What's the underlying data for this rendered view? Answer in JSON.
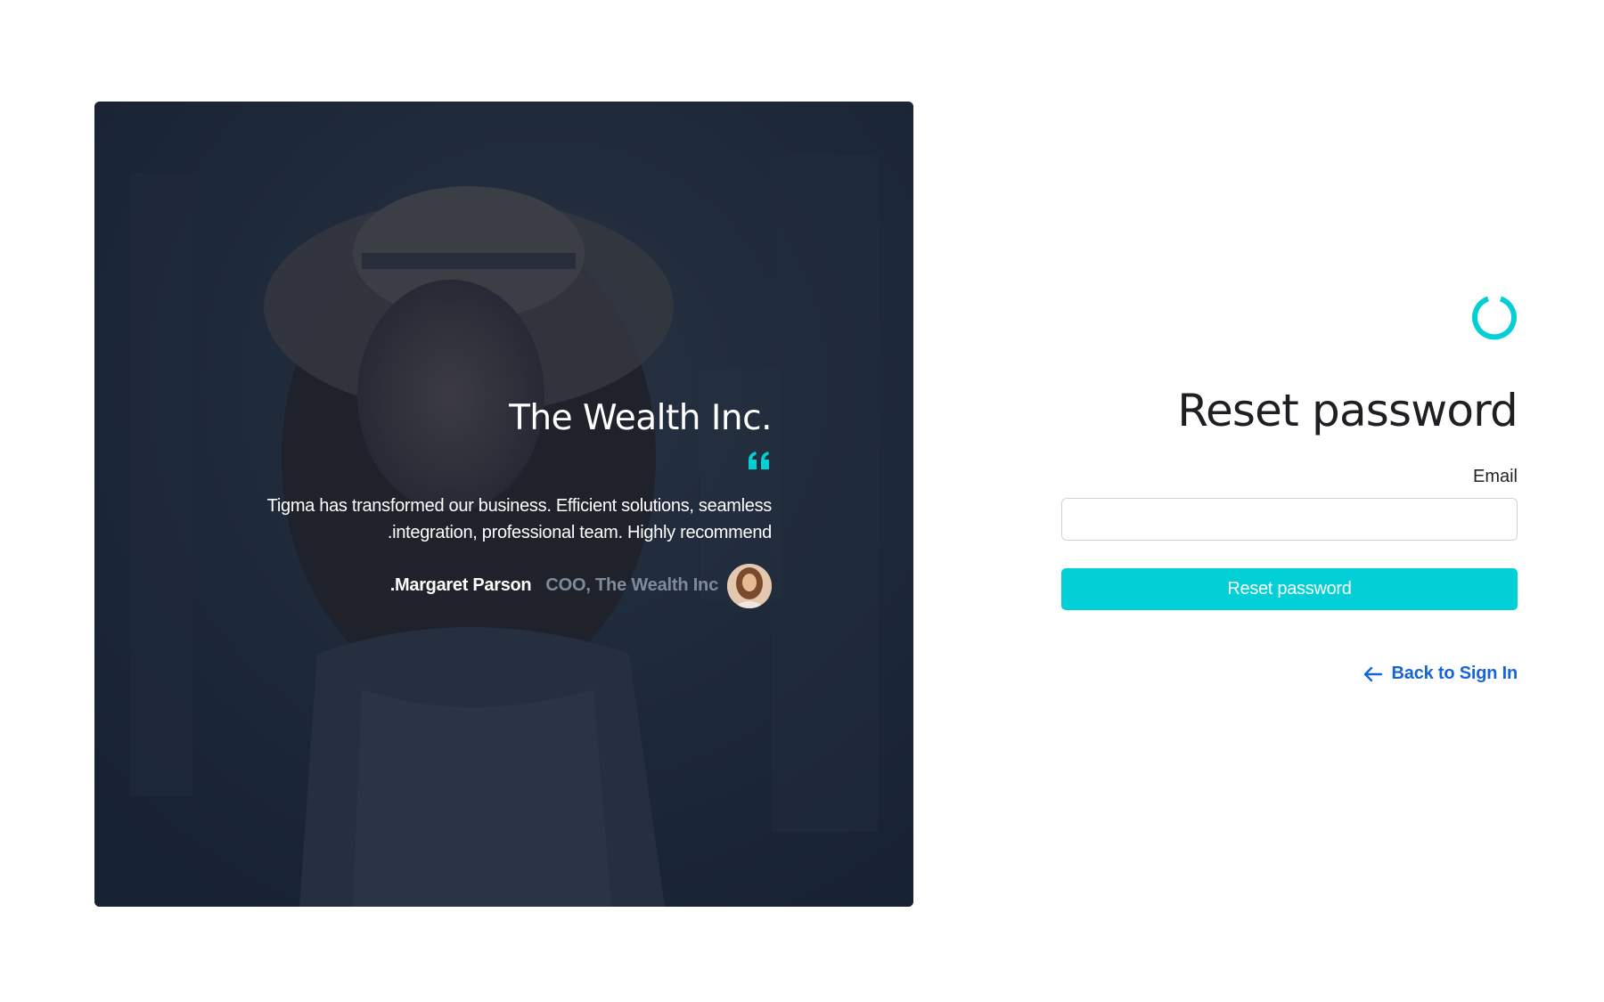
{
  "testimonial": {
    "company_title": ".The Wealth Inc",
    "quote_text": "Tigma has transformed our business. Efficient solutions, seamless integration, professional team. Highly recommend.",
    "author_name": "Margaret Parson.",
    "author_role": "COO, The Wealth Inc",
    "quote_icon": "quote-icon",
    "avatar_icon": "avatar"
  },
  "form": {
    "logo_icon": "loader-ring-icon",
    "title": "Reset password",
    "email_label": "Email",
    "email_value": "",
    "email_placeholder": "",
    "submit_label": "Reset password",
    "back_label": "Back to Sign In",
    "back_icon": "arrow-left-icon"
  },
  "colors": {
    "accent": "#02d0d6",
    "link": "#1565d8",
    "panel_overlay": "#162133"
  }
}
